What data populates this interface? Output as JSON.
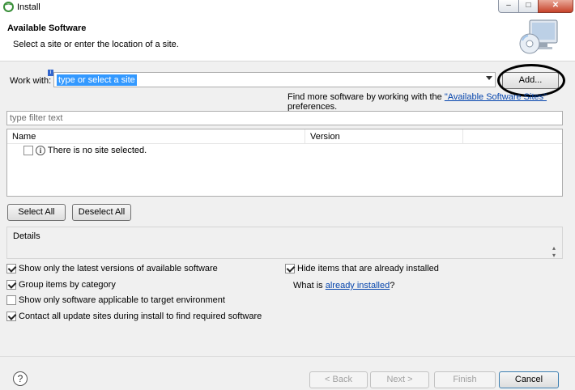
{
  "window": {
    "title": "Install",
    "minimize_label": "–",
    "maximize_label": "□",
    "close_label": "✕"
  },
  "header": {
    "title": "Available Software",
    "description": "Select a site or enter the location of a site."
  },
  "work_with": {
    "label": "Work with:",
    "placeholder": "type or select a site",
    "info_marker": "i",
    "add_label": "Add...",
    "find_more_prefix": "Find more software by working with the ",
    "find_more_link": "\"Available Software Sites\"",
    "find_more_suffix": " preferences."
  },
  "filter": {
    "placeholder": "type filter text"
  },
  "table": {
    "columns": [
      "Name",
      "Version"
    ],
    "empty_message": "There is no site selected."
  },
  "selection_buttons": {
    "select_all": "Select All",
    "deselect_all": "Deselect All"
  },
  "details": {
    "label": "Details",
    "scroll_glyph": "▴\n▾"
  },
  "options": {
    "latest_versions": {
      "label": "Show only the latest versions of available software",
      "checked": true
    },
    "group_by_category": {
      "label": "Group items by category",
      "checked": true
    },
    "applicable_only": {
      "label": "Show only software applicable to target environment",
      "checked": false
    },
    "contact_all_sites": {
      "label": "Contact all update sites during install to find required software",
      "checked": true
    },
    "hide_installed": {
      "label": "Hide items that are already installed",
      "checked": true
    }
  },
  "what_is": {
    "prefix": "What is ",
    "link": "already installed",
    "suffix": "?"
  },
  "footer": {
    "help_glyph": "?",
    "back": "< Back",
    "next": "Next >",
    "finish": "Finish",
    "cancel": "Cancel"
  },
  "colors": {
    "accent": "#3399ff",
    "link": "#0645ad"
  }
}
